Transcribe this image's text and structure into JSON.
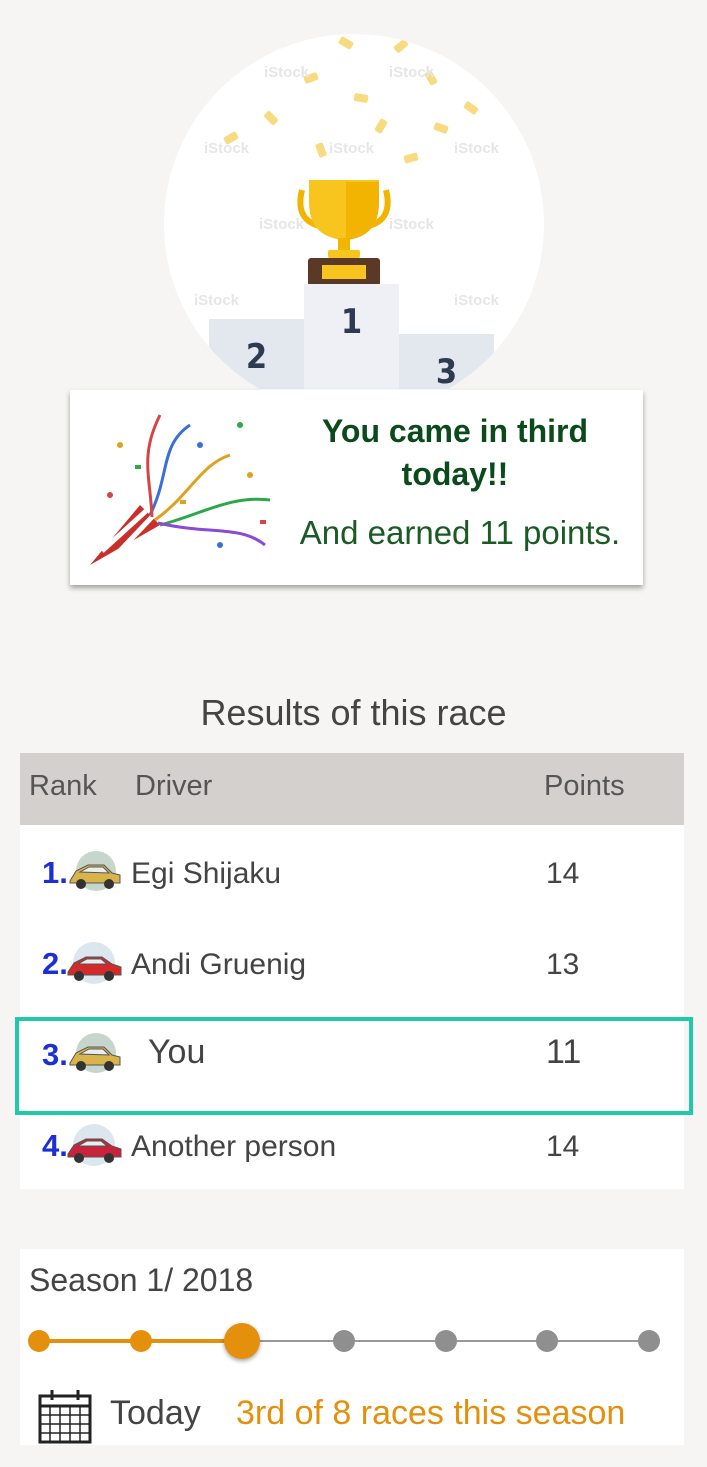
{
  "hero": {
    "watermark": "iStock",
    "podium": {
      "first": "1",
      "second": "2",
      "third": "3"
    }
  },
  "banner": {
    "title": "You came in third today!!",
    "subtitle": "And earned 11 points."
  },
  "results": {
    "title": "Results of this race",
    "headers": {
      "rank": "Rank",
      "driver": "Driver",
      "points": "Points"
    },
    "rows": [
      {
        "rank": "1.",
        "car": "yellow-car-icon",
        "name": "Egi Shijaku",
        "points": "14"
      },
      {
        "rank": "2.",
        "car": "red-car-icon",
        "name": "Andi Gruenig",
        "points": "13"
      },
      {
        "rank": "3.",
        "car": "yellow-car-icon",
        "name": "You",
        "points": "11"
      },
      {
        "rank": "4.",
        "car": "red-car-icon",
        "name": "Another person",
        "points": "14"
      }
    ]
  },
  "season": {
    "label": "Season 1/ 2018",
    "total_races": 8,
    "current_race": 3,
    "today_label": "Today",
    "progress_text": "3rd of 8 races this season",
    "accent_color": "#e4900c",
    "highlight_color": "#20c9a8"
  }
}
